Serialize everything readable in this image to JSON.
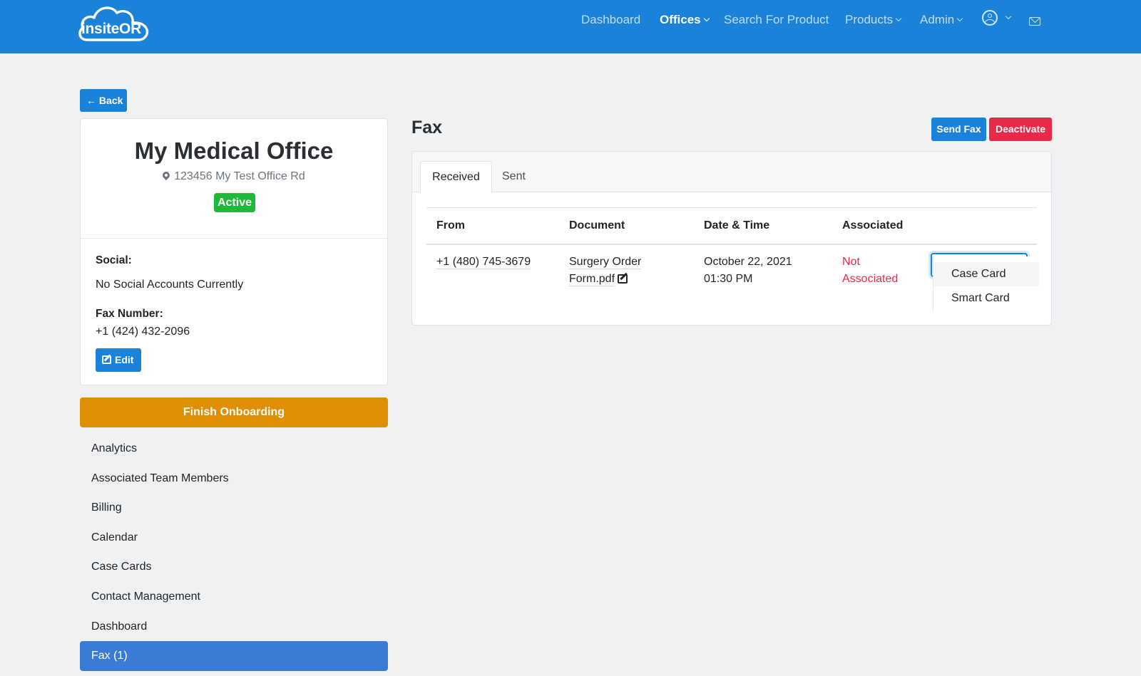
{
  "brand": {
    "logo_text": "insiteOR"
  },
  "nav": {
    "items": [
      {
        "label": "Dashboard",
        "dropdown": false,
        "active": false
      },
      {
        "label": "Offices",
        "dropdown": true,
        "active": true
      },
      {
        "label": "Search For Product",
        "dropdown": false,
        "active": false
      },
      {
        "label": "Products",
        "dropdown": true,
        "active": false
      },
      {
        "label": "Admin",
        "dropdown": true,
        "active": false
      }
    ],
    "user_icon": "user-circle-icon",
    "mail_icon": "envelope-icon"
  },
  "back_button": {
    "label": "Back",
    "icon": "arrow-left-icon"
  },
  "office": {
    "name": "My Medical Office",
    "address": "123456 My Test Office Rd",
    "status": "Active",
    "social_label": "Social:",
    "social_value": "No Social Accounts Currently",
    "fax_label": "Fax Number:",
    "fax_value": "+1 (424) 432-2096",
    "edit_label": "Edit"
  },
  "onboarding_button": "Finish Onboarding",
  "sidebar": {
    "items": [
      {
        "label": "Analytics",
        "active": false
      },
      {
        "label": "Associated Team Members",
        "active": false
      },
      {
        "label": "Billing",
        "active": false
      },
      {
        "label": "Calendar",
        "active": false
      },
      {
        "label": "Case Cards",
        "active": false
      },
      {
        "label": "Contact Management",
        "active": false
      },
      {
        "label": "Dashboard",
        "active": false
      },
      {
        "label": "Fax (1)",
        "active": true
      }
    ]
  },
  "fax": {
    "title": "Fax",
    "send_label": "Send Fax",
    "deactivate_label": "Deactivate",
    "tabs": [
      {
        "label": "Received",
        "active": true
      },
      {
        "label": "Sent",
        "active": false
      }
    ],
    "columns": [
      "From",
      "Document",
      "Date & Time",
      "Associated"
    ],
    "rows": [
      {
        "from": "+1 (480) 745-3679",
        "document_line1": "Surgery Order",
        "document_line2": "Form.pdf",
        "date_line1": "October 22, 2021",
        "date_line2": "01:30 PM",
        "associated_line1": "Not",
        "associated_line2": "Associated"
      }
    ],
    "association_options": [
      "Case Card",
      "Smart Card"
    ]
  },
  "colors": {
    "primary": "#1a82d9",
    "danger": "#e8294a",
    "success": "#1eb83a",
    "warning": "#e08e06",
    "sidebar_active": "#3a7bd5"
  }
}
